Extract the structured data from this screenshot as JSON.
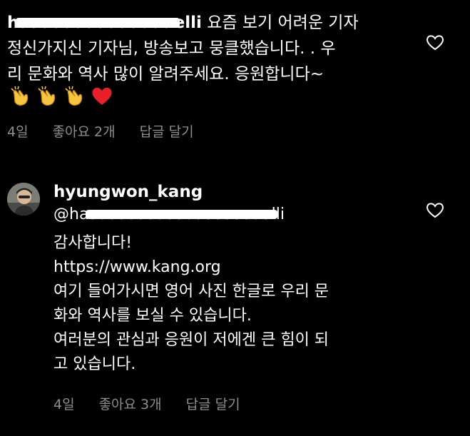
{
  "comment1": {
    "username_visible": "h",
    "username_tail": "elli",
    "text_line1": "요즘 보기 어려운 기자",
    "text_line2": "정신가지신 기자님, 방송보고 뭉클했습니다. . 우",
    "text_line3": "리 문화와 역사 많이 알려주세요. 응원합니다~",
    "emojis": [
      "clapping-hands",
      "clapping-hands",
      "clapping-hands",
      "red-heart"
    ],
    "time": "4일",
    "likes": "좋아요 2개",
    "reply": "답글 달기"
  },
  "comment2": {
    "username": "hyungwon_kang",
    "mention_start": "@ha",
    "mention_tail": "lli",
    "line1": "감사합니다!",
    "line2": "https://www.kang.org",
    "line3": "여기 들어가시면 영어 사진 한글로 우리 문",
    "line4": "화와 역사를 보실 수 있습니다.",
    "line5": "여러분의 관심과 응원이 저에겐 큰 힘이 되",
    "line6": "고 있습니다.",
    "time": "4일",
    "likes": "좋아요 3개",
    "reply": "답글 달기"
  },
  "colors": {
    "background": "#000000",
    "text": "#ffffff",
    "meta": "#8e8e8e",
    "heart_emoji": "#e8202a"
  },
  "icons": {
    "like": "heart-outline-icon"
  }
}
